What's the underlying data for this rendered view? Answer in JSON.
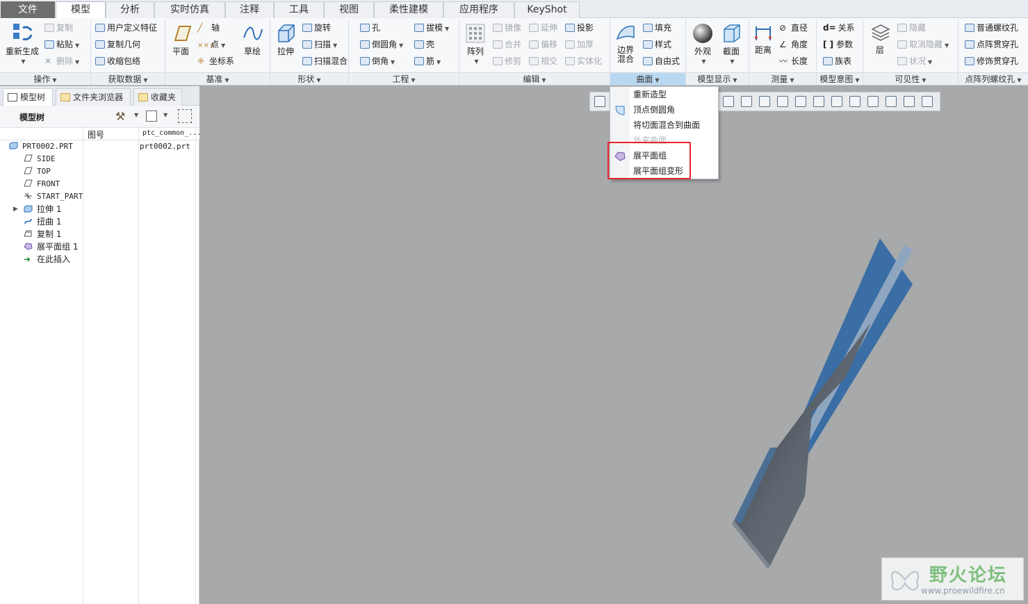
{
  "tabs": [
    "文件",
    "模型",
    "分析",
    "实时仿真",
    "注释",
    "工具",
    "视图",
    "柔性建模",
    "应用程序",
    "KeyShot"
  ],
  "ribbon": {
    "operations": {
      "label": "操作",
      "regenerate": "重新生成",
      "copy": "复制",
      "paste": "粘贴",
      "delete": "删除"
    },
    "get_data": {
      "label": "获取数据",
      "udf": "用户定义特征",
      "copy_geom": "复制几何",
      "shrinkwrap": "收缩包络"
    },
    "datum": {
      "label": "基准",
      "plane": "平面",
      "axis": "轴",
      "point": "点",
      "csys": "坐标系",
      "sketch": "草绘"
    },
    "shapes": {
      "label": "形状",
      "extrude": "拉伸",
      "revolve": "旋转",
      "sweep": "扫描",
      "swept_blend": "扫描混合"
    },
    "engineering": {
      "label": "工程",
      "hole": "孔",
      "round": "倒圆角",
      "chamfer": "倒角",
      "draft": "拔模",
      "shell": "壳",
      "rib": "筋"
    },
    "editing": {
      "label": "编辑",
      "pattern": "阵列",
      "mirror": "镜像",
      "extend": "延伸",
      "project": "投影",
      "merge": "合并",
      "offset": "偏移",
      "thicken": "加厚",
      "trim": "修剪",
      "intersect": "相交",
      "solidify": "实体化"
    },
    "surfaces": {
      "label": "曲面",
      "boundary_blend_1": "边界",
      "boundary_blend_2": "混合",
      "fill": "填充",
      "style": "样式",
      "freestyle": "自由式"
    },
    "model_display": {
      "label": "模型显示",
      "appearance": "外观",
      "section": "截面"
    },
    "measure": {
      "label": "测量",
      "distance": "距离",
      "diameter": "直径",
      "angle": "角度",
      "length": "长度"
    },
    "model_intent": {
      "label": "模型意图",
      "relations": "关系",
      "parameters": "参数",
      "family_table": "族表"
    },
    "visibility": {
      "label": "可见性",
      "layer": "层",
      "hide": "隐藏",
      "unhide": "取消隐藏",
      "status": "状况"
    },
    "thread": {
      "label": "点阵列螺纹孔",
      "normal": "普通螺纹孔",
      "point_thru": "点阵贯穿孔",
      "cosmetic": "修饰贯穿孔"
    }
  },
  "panel_tabs": [
    "模型树",
    "文件夹浏览器",
    "收藏夹"
  ],
  "tree": {
    "title": "模型树",
    "columns": [
      "图号",
      "ptc_common_..."
    ],
    "rows": [
      {
        "name": "PRT0002.PRT",
        "value": "prt0002.prt"
      },
      {
        "name": "SIDE",
        "value": ""
      },
      {
        "name": "TOP",
        "value": ""
      },
      {
        "name": "FRONT",
        "value": ""
      },
      {
        "name": "START_PART",
        "value": ""
      },
      {
        "name": "拉伸 1",
        "value": ""
      },
      {
        "name": "扭曲 1",
        "value": ""
      },
      {
        "name": "复制 1",
        "value": ""
      },
      {
        "name": "展平面组 1",
        "value": ""
      },
      {
        "name": "在此插入",
        "value": ""
      }
    ]
  },
  "dropdown": {
    "items": [
      {
        "label": "重新造型",
        "enabled": true
      },
      {
        "label": "顶点倒圆角",
        "enabled": true
      },
      {
        "label": "将切面混合到曲面",
        "enabled": true
      },
      {
        "label": "外来曲面",
        "enabled": false
      },
      {
        "label": "展平面组",
        "enabled": true
      },
      {
        "label": "展平面组变形",
        "enabled": true
      }
    ]
  },
  "watermark": {
    "title": "野火论坛",
    "url": "www.proewildfire.cn"
  },
  "colors": {
    "accent": "#b9d9f3",
    "highlight_box": "#e8232a",
    "model_blue": "#3a6ea5",
    "model_gray": "#59616b",
    "viewport_bg": "#a8a9ab"
  }
}
